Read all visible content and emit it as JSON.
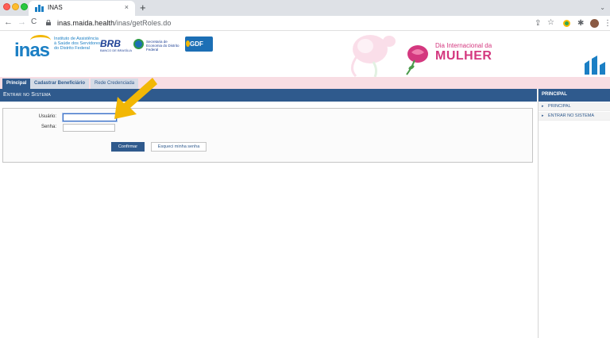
{
  "browser": {
    "tab_title": "INAS",
    "tab_close": "×",
    "new_tab": "+",
    "url_host": "inas.maida.health",
    "url_path": "/inas/getRoles.do",
    "back": "←",
    "forward": "→",
    "reload": "C",
    "share_icon": "share-icon",
    "bookmark": "☆"
  },
  "header": {
    "inas_logo": "inas",
    "inas_description": "Instituto de Assistência à Saúde dos Servidores do Distrito Federal",
    "brb_logo": "BRB",
    "brb_sub": "BANCO DE BRASÍLIA",
    "secretaria_text": "Secretaria de Economia do Distrito Federal",
    "gdf_logo": "GDF",
    "banner_line1": "Dia Internacional da",
    "banner_line2": "MULHER",
    "accent_pink": "#d4387f",
    "brand_blue": "#1b7fc4"
  },
  "nav": {
    "tabs": [
      {
        "label": "Principal",
        "active": true
      },
      {
        "label": "Cadastrar Beneficiário",
        "active": false
      },
      {
        "label": "Rede Credenciada",
        "active": false
      }
    ]
  },
  "main": {
    "panel_title": "Entrar no Sistema",
    "username_label": "Usuário:",
    "username_value": "",
    "password_label": "Senha:",
    "password_value": "",
    "confirm_label": "Confirmar",
    "forgot_label": "Esqueci minha senha"
  },
  "sidebar": {
    "title": "PRINCIPAL",
    "items": [
      {
        "label": "PRINCIPAL"
      },
      {
        "label": "ENTRAR NO SISTEMA"
      }
    ]
  },
  "colors": {
    "panel_blue": "#2f5a8d",
    "nav_pink": "#f8dde3",
    "arrow_yellow": "#f2b705"
  }
}
